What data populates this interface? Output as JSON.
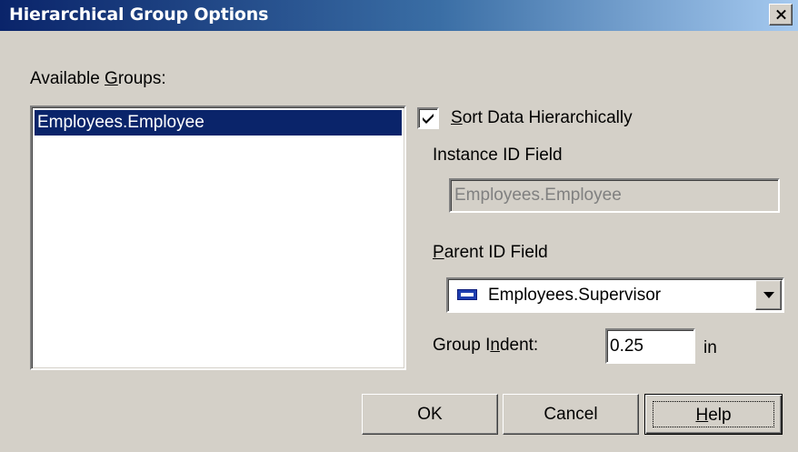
{
  "window": {
    "title": "Hierarchical Group Options"
  },
  "groups": {
    "label_before": "Available ",
    "label_accel": "G",
    "label_after": "roups:",
    "items": [
      "Employees.Employee"
    ],
    "selected_index": 0
  },
  "sort": {
    "label_accel": "S",
    "label_rest": "ort Data Hierarchically",
    "checked": true
  },
  "instance_id": {
    "label": "Instance ID Field",
    "value": "Employees.Employee"
  },
  "parent_id": {
    "label_accel": "P",
    "label_rest": "arent ID Field",
    "value": "Employees.Supervisor",
    "icon": "field-icon"
  },
  "indent": {
    "label_before": "Group I",
    "label_accel": "n",
    "label_after": "dent:",
    "value": "0.25",
    "unit": "in"
  },
  "buttons": {
    "ok": "OK",
    "cancel": "Cancel",
    "help_accel": "H",
    "help_rest": "elp"
  },
  "colors": {
    "selection": "#0a246a",
    "face": "#d4d0c8",
    "disabled_text": "#808080"
  }
}
